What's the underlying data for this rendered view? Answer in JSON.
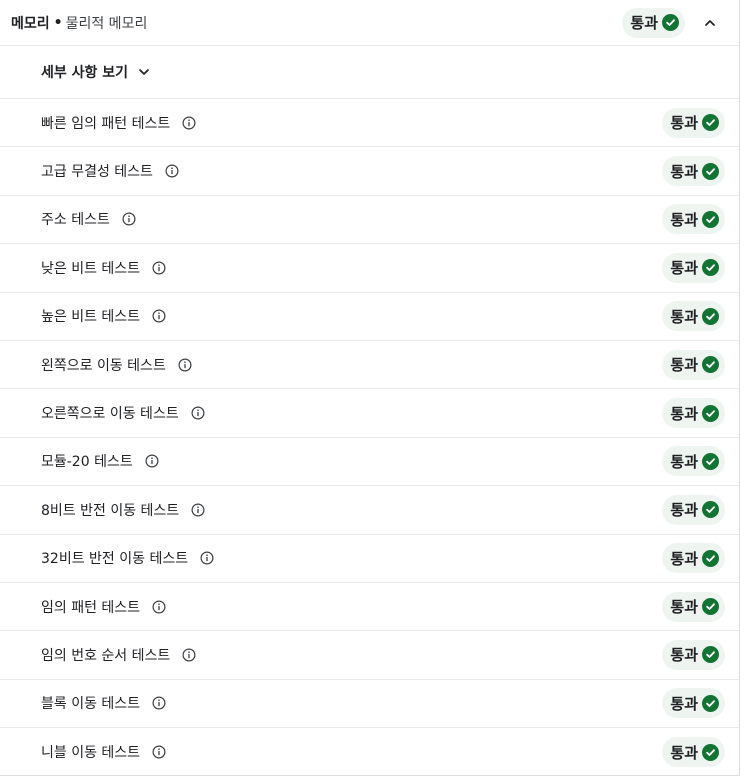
{
  "header": {
    "title": "메모리",
    "separator": "•",
    "subtitle": "물리적 메모리",
    "status_label": "통과"
  },
  "details_toggle": {
    "label": "세부 사항 보기"
  },
  "tests": [
    {
      "name": "빠른 임의 패턴 테스트",
      "status": "통과"
    },
    {
      "name": "고급 무결성 테스트",
      "status": "통과"
    },
    {
      "name": "주소 테스트",
      "status": "통과"
    },
    {
      "name": "낮은 비트 테스트",
      "status": "통과"
    },
    {
      "name": "높은 비트 테스트",
      "status": "통과"
    },
    {
      "name": "왼쪽으로 이동 테스트",
      "status": "통과"
    },
    {
      "name": "오른쪽으로 이동 테스트",
      "status": "통과"
    },
    {
      "name": "모듈-20 테스트",
      "status": "통과"
    },
    {
      "name": "8비트 반전 이동 테스트",
      "status": "통과"
    },
    {
      "name": "32비트 반전 이동 테스트",
      "status": "통과"
    },
    {
      "name": "임의 패턴 테스트",
      "status": "통과"
    },
    {
      "name": "임의 번호 순서 테스트",
      "status": "통과"
    },
    {
      "name": "블록 이동 테스트",
      "status": "통과"
    },
    {
      "name": "니블 이동 테스트",
      "status": "통과"
    }
  ],
  "colors": {
    "pass_green": "#137333",
    "badge_bg": "#eef5f0",
    "divider": "#e8eaed"
  },
  "icons": {
    "status": "check-circle-icon",
    "info": "info-icon",
    "collapse": "chevron-up-icon",
    "expand": "chevron-down-icon"
  }
}
